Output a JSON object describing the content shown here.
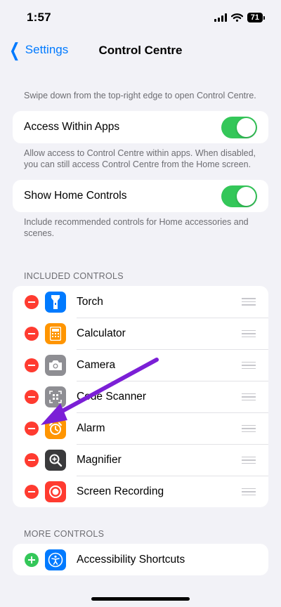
{
  "status": {
    "time": "1:57",
    "battery": "71"
  },
  "nav": {
    "back_label": "Settings",
    "title": "Control Centre"
  },
  "intro_desc": "Swipe down from the top-right edge to open Control Centre.",
  "toggles": [
    {
      "label": "Access Within Apps",
      "on": true,
      "desc": "Allow access to Control Centre within apps. When disabled, you can still access Control Centre from the Home screen."
    },
    {
      "label": "Show Home Controls",
      "on": true,
      "desc": "Include recommended controls for Home accessories and scenes."
    }
  ],
  "included": {
    "header": "INCLUDED CONTROLS",
    "items": [
      {
        "label": "Torch",
        "icon": "torch-icon",
        "color": "#007aff"
      },
      {
        "label": "Calculator",
        "icon": "calculator-icon",
        "color": "#ff9500"
      },
      {
        "label": "Camera",
        "icon": "camera-icon",
        "color": "#8e8e93"
      },
      {
        "label": "Code Scanner",
        "icon": "qr-code-icon",
        "color": "#8e8e93"
      },
      {
        "label": "Alarm",
        "icon": "alarm-icon",
        "color": "#ff9500"
      },
      {
        "label": "Magnifier",
        "icon": "magnifier-icon",
        "color": "#3a3a3c"
      },
      {
        "label": "Screen Recording",
        "icon": "record-icon",
        "color": "#ff3b30"
      }
    ]
  },
  "more": {
    "header": "MORE CONTROLS",
    "items": [
      {
        "label": "Accessibility Shortcuts",
        "icon": "accessibility-icon",
        "color": "#007aff"
      }
    ]
  },
  "colors": {
    "accent": "#007aff",
    "switch_on": "#34c759",
    "remove": "#ff3b30",
    "annotation_arrow": "#7b1fd6"
  }
}
